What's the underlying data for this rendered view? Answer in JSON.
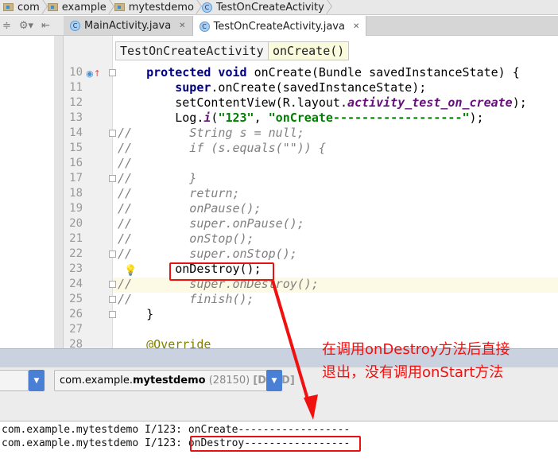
{
  "breadcrumbs": [
    "com",
    "example",
    "mytestdemo",
    "TestOnCreateActivity"
  ],
  "tabs": [
    {
      "label": "MainActivity.java"
    },
    {
      "label": "TestOnCreateActivity.java",
      "active": true
    }
  ],
  "nav": {
    "class_label": "TestOnCreateActivity",
    "method_label": "onCreate()"
  },
  "code": [
    {
      "n": "10",
      "tokens": [
        [
          "    "
        ],
        [
          "protected void ",
          "kw"
        ],
        [
          "onCreate(Bundle savedInstanceState) {"
        ]
      ]
    },
    {
      "n": "11",
      "tokens": [
        [
          "        "
        ],
        [
          "super",
          "kw"
        ],
        [
          ".onCreate(savedInstanceState);"
        ]
      ]
    },
    {
      "n": "12",
      "tokens": [
        [
          "        setContentView(R.layout."
        ],
        [
          "activity_test_on_create",
          "it"
        ],
        [
          ");"
        ]
      ]
    },
    {
      "n": "13",
      "tokens": [
        [
          "        Log."
        ],
        [
          "i",
          "it"
        ],
        [
          "("
        ],
        [
          "\"123\"",
          "str"
        ],
        [
          ", "
        ],
        [
          "\"onCreate------------------\"",
          "str"
        ],
        [
          ");"
        ]
      ]
    },
    {
      "n": "14",
      "tokens": [
        [
          "//        String s = null;",
          "cm"
        ]
      ]
    },
    {
      "n": "15",
      "tokens": [
        [
          "//        if (s.equals(\"\")) {",
          "cm"
        ]
      ]
    },
    {
      "n": "16",
      "tokens": [
        [
          "//",
          "cm"
        ]
      ]
    },
    {
      "n": "17",
      "tokens": [
        [
          "//        }",
          "cm"
        ]
      ]
    },
    {
      "n": "18",
      "tokens": [
        [
          "//        return;",
          "cm"
        ]
      ]
    },
    {
      "n": "19",
      "tokens": [
        [
          "//        onPause();",
          "cm"
        ]
      ]
    },
    {
      "n": "20",
      "tokens": [
        [
          "//        super.onPause();",
          "cm"
        ]
      ]
    },
    {
      "n": "21",
      "tokens": [
        [
          "//        onStop();",
          "cm"
        ]
      ]
    },
    {
      "n": "22",
      "tokens": [
        [
          "//        super.onStop();",
          "cm"
        ]
      ]
    },
    {
      "n": "23",
      "tokens": [
        [
          "        onDestroy();"
        ]
      ]
    },
    {
      "n": "24",
      "tokens": [
        [
          "//        super.onDestroy();",
          "cm"
        ]
      ]
    },
    {
      "n": "25",
      "tokens": [
        [
          "//        finish();",
          "cm"
        ]
      ]
    },
    {
      "n": "26",
      "tokens": [
        [
          "    }"
        ]
      ]
    },
    {
      "n": "27",
      "tokens": [
        [
          ""
        ]
      ]
    },
    {
      "n": "28",
      "tokens": [
        [
          "    "
        ],
        [
          "@Override",
          "ann"
        ]
      ]
    }
  ],
  "process_select": {
    "prefix": "com.example.",
    "bold": "mytestdemo",
    "pid": " (28150) ",
    "status": "[DEAD]"
  },
  "log": [
    {
      "prefix": "com.example.mytestdemo I/123: ",
      "msg": "onCreate------------------"
    },
    {
      "prefix": "com.example.mytestdemo I/123: ",
      "msg": "onDestroy-----------------"
    }
  ],
  "annotation": {
    "line1": "在调用onDestroy方法后直接",
    "line2": "退出，没有调用onStart方法",
    "color": "#f01010"
  }
}
